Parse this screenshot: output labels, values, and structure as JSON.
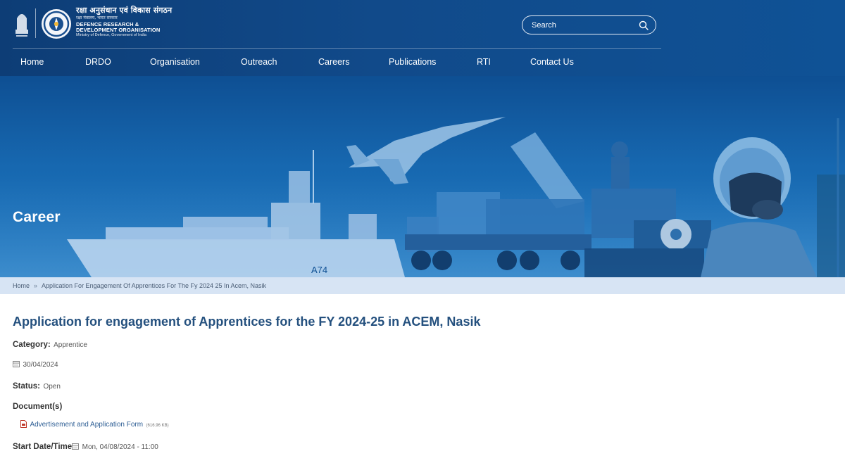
{
  "header": {
    "org_name_hindi": "रक्षा अनुसंधान एवं विकास संगठन",
    "org_subtitle_hindi": "रक्षा मंत्रालय, भारत सरकार",
    "org_name_line1": "DEFENCE RESEARCH &",
    "org_name_line2": "DEVELOPMENT ORGANISATION",
    "ministry": "Ministry of Defence, Government of India",
    "search_placeholder": "Search"
  },
  "nav": {
    "items": [
      {
        "label": "Home"
      },
      {
        "label": "DRDO"
      },
      {
        "label": "Organisation"
      },
      {
        "label": "Outreach"
      },
      {
        "label": "Careers"
      },
      {
        "label": "Publications"
      },
      {
        "label": "RTI"
      },
      {
        "label": "Contact Us"
      }
    ]
  },
  "banner": {
    "title": "Career",
    "ship_hull_number": "A74"
  },
  "breadcrumb": {
    "home": "Home",
    "separator": "»",
    "current": "Application For Engagement Of Apprentices For The Fy 2024 25 In Acem, Nasik"
  },
  "article": {
    "title": "Application for engagement of Apprentices for the FY 2024-25 in ACEM, Nasik",
    "category_label": "Category:",
    "category_value": "Apprentice",
    "date": "30/04/2024",
    "status_label": "Status:",
    "status_value": "Open",
    "documents_label": "Document(s)",
    "document_name": "Advertisement and Application Form",
    "document_size": "(616.96 KB)",
    "start_label": "Start Date/Time",
    "start_value": "Mon, 04/08/2024 - 11:00"
  },
  "colors": {
    "header_bg": "#0d3d76",
    "title_blue": "#24507e",
    "breadcrumb_bg": "#d7e4f4",
    "link_blue": "#2f5f95"
  }
}
